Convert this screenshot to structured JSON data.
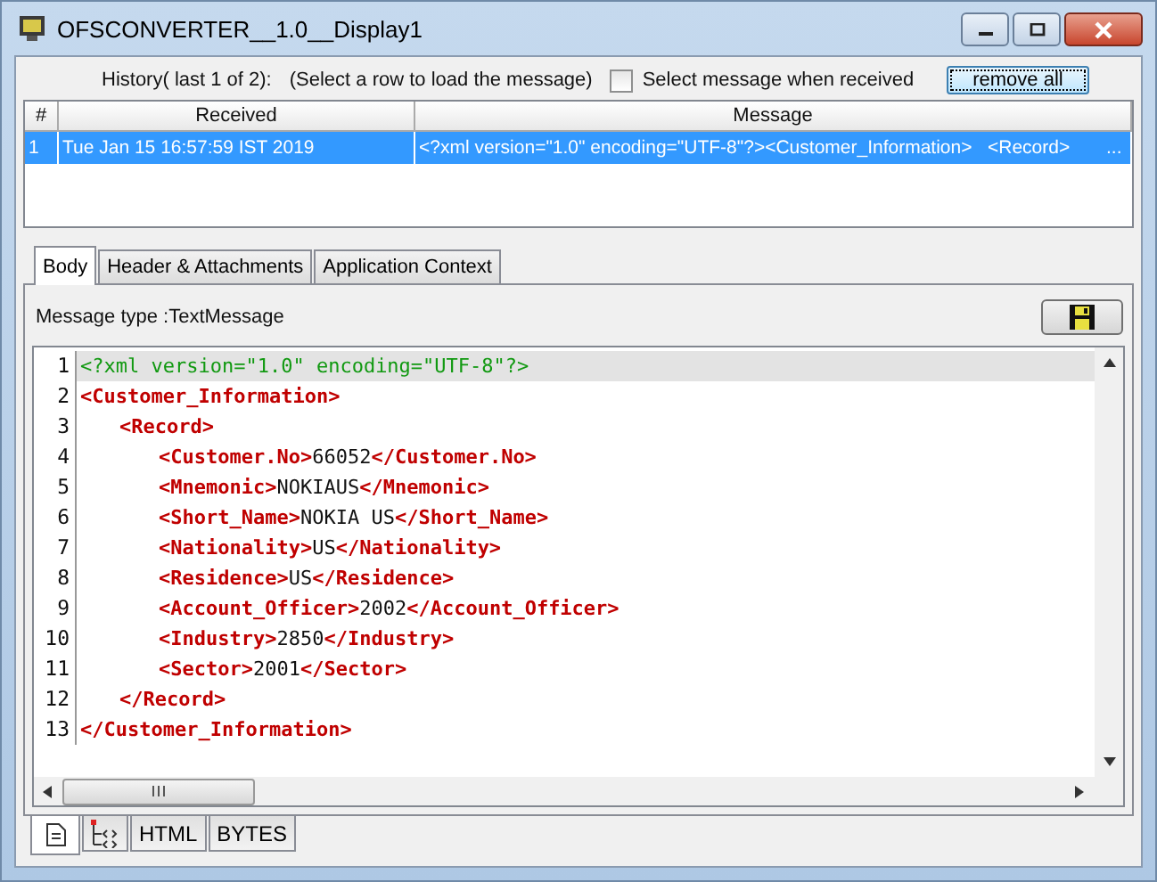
{
  "window": {
    "title": "OFSCONVERTER__1.0__Display1"
  },
  "history": {
    "label": "History( last 1 of 2):",
    "hint": "(Select a row to load the message)",
    "auto_select": {
      "label": "Select message when received",
      "checked": false
    },
    "remove_button": "remove all"
  },
  "table": {
    "columns": [
      "#",
      "Received",
      "Message"
    ],
    "rows": [
      {
        "cells": [
          "1",
          "Tue Jan 15 16:57:59 IST 2019",
          "<?xml version=\"1.0\" encoding=\"UTF-8\"?><Customer_Information>   <Record>       ..."
        ],
        "selected": true
      }
    ]
  },
  "tabs": [
    {
      "label": "Body",
      "selected": true
    },
    {
      "label": "Header & Attachments",
      "selected": false
    },
    {
      "label": "Application Context",
      "selected": false
    }
  ],
  "message_type": "Message type :TextMessage",
  "code_lines": [
    {
      "num": "1",
      "highlighted": true,
      "parts": [
        {
          "kind": "decl",
          "text": "<?xml version=\"1.0\" encoding=\"UTF-8\"?>"
        }
      ]
    },
    {
      "num": "2",
      "highlighted": false,
      "parts": [
        {
          "kind": "tag",
          "text": "<Customer_Information>"
        }
      ],
      "children": [
        {
          "num": "3",
          "highlighted": false,
          "parts": [
            {
              "kind": "tag",
              "text": "<Record>"
            }
          ],
          "children": [
            {
              "num": "4",
              "highlighted": false,
              "parts": [
                {
                  "kind": "tag",
                  "text": "<Customer.No>"
                },
                {
                  "kind": "text",
                  "text": "66052"
                },
                {
                  "kind": "tag",
                  "text": "</Customer.No>"
                }
              ]
            },
            {
              "num": "5",
              "highlighted": false,
              "parts": [
                {
                  "kind": "tag",
                  "text": "<Mnemonic>"
                },
                {
                  "kind": "text",
                  "text": "NOKIAUS"
                },
                {
                  "kind": "tag",
                  "text": "</Mnemonic>"
                }
              ]
            },
            {
              "num": "6",
              "highlighted": false,
              "parts": [
                {
                  "kind": "tag",
                  "text": "<Short_Name>"
                },
                {
                  "kind": "text",
                  "text": "NOKIA US"
                },
                {
                  "kind": "tag",
                  "text": "</Short_Name>"
                }
              ]
            },
            {
              "num": "7",
              "highlighted": false,
              "parts": [
                {
                  "kind": "tag",
                  "text": "<Nationality>"
                },
                {
                  "kind": "text",
                  "text": "US"
                },
                {
                  "kind": "tag",
                  "text": "</Nationality>"
                }
              ]
            },
            {
              "num": "8",
              "highlighted": false,
              "parts": [
                {
                  "kind": "tag",
                  "text": "<Residence>"
                },
                {
                  "kind": "text",
                  "text": "US"
                },
                {
                  "kind": "tag",
                  "text": "</Residence>"
                }
              ]
            },
            {
              "num": "9",
              "highlighted": false,
              "parts": [
                {
                  "kind": "tag",
                  "text": "<Account_Officer>"
                },
                {
                  "kind": "text",
                  "text": "2002"
                },
                {
                  "kind": "tag",
                  "text": "</Account_Officer>"
                }
              ]
            },
            {
              "num": "10",
              "highlighted": false,
              "parts": [
                {
                  "kind": "tag",
                  "text": "<Industry>"
                },
                {
                  "kind": "text",
                  "text": "2850"
                },
                {
                  "kind": "tag",
                  "text": "</Industry>"
                }
              ]
            },
            {
              "num": "11",
              "highlighted": false,
              "parts": [
                {
                  "kind": "tag",
                  "text": "<Sector>"
                },
                {
                  "kind": "text",
                  "text": "2001"
                },
                {
                  "kind": "tag",
                  "text": "</Sector>"
                }
              ]
            }
          ]
        },
        {
          "num": "12",
          "highlighted": false,
          "parts": [
            {
              "kind": "tag",
              "text": "</Record>"
            }
          ]
        }
      ]
    },
    {
      "num": "13",
      "highlighted": false,
      "parts": [
        {
          "kind": "tag",
          "text": "</Customer_Information>"
        }
      ]
    }
  ],
  "view_tabs": [
    {
      "kind": "document",
      "selected": true
    },
    {
      "kind": "tree",
      "selected": false
    },
    {
      "kind": "label",
      "label": "HTML",
      "selected": false
    },
    {
      "kind": "label",
      "label": "BYTES",
      "selected": false
    }
  ]
}
